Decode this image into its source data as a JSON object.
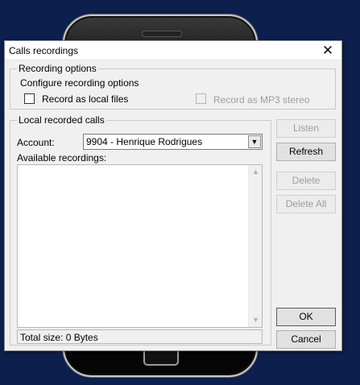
{
  "dialog": {
    "title": "Calls recordings",
    "close_glyph": "✕"
  },
  "recording_options": {
    "group_label": "Recording options",
    "configure_label": "Configure recording options",
    "record_local_label": "Record as local files",
    "record_local_checked": false,
    "record_mp3_label": "Record as MP3 stereo",
    "record_mp3_checked": false
  },
  "local_calls": {
    "group_label": "Local recorded calls",
    "account_label": "Account:",
    "account_value": "9904 - Henrique Rodrigues",
    "available_label": "Available recordings:",
    "recordings": [],
    "total_size": "Total size: 0 Bytes"
  },
  "buttons": {
    "listen": "Listen",
    "refresh": "Refresh",
    "delete": "Delete",
    "delete_all": "Delete All",
    "ok": "OK",
    "cancel": "Cancel"
  },
  "icons": {
    "combo_arrow": "chevron-down-icon",
    "scroll_up": "scroll-up-icon",
    "scroll_down": "scroll-down-icon"
  }
}
